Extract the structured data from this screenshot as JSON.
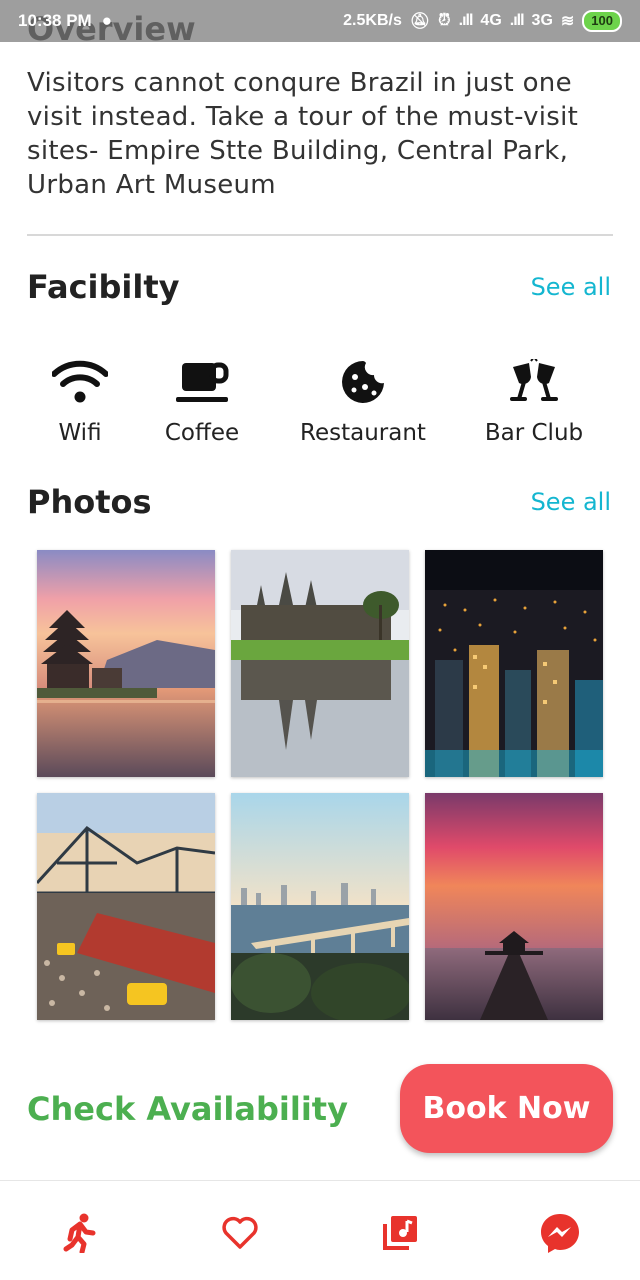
{
  "status_bar": {
    "time": "10:38 PM",
    "speed": "2.5KB/s",
    "network_4g": "4G",
    "network_3g": "3G",
    "battery": "100"
  },
  "overview": {
    "title": "Overview",
    "text": "Visitors cannot conqure Brazil  in just one visit instead. Take a tour of the must-visit sites- Empire Stte Building, Central Park, Urban Art Museum"
  },
  "facility": {
    "title": "Facibilty",
    "see_all": "See all",
    "items": [
      {
        "label": "Wifi",
        "icon": "wifi-icon"
      },
      {
        "label": "Coffee",
        "icon": "coffee-icon"
      },
      {
        "label": "Restaurant",
        "icon": "cookie-icon"
      },
      {
        "label": "Bar Club",
        "icon": "glasses-icon"
      }
    ]
  },
  "photos": {
    "title": "Photos",
    "see_all": "See all",
    "items": [
      "temple-lake-photo",
      "angkor-wat-photo",
      "city-night-photo",
      "bridge-street-photo",
      "sea-link-photo",
      "pier-sunset-photo"
    ]
  },
  "actions": {
    "check_availability": "Check Availability",
    "book_now": "Book Now"
  },
  "bottom_nav": [
    "walk-icon",
    "heart-icon",
    "music-library-icon",
    "messenger-icon"
  ],
  "colors": {
    "accent_teal": "#14b6d0",
    "green": "#4caf50",
    "red": "#f3545b",
    "nav_red": "#e8332c"
  }
}
